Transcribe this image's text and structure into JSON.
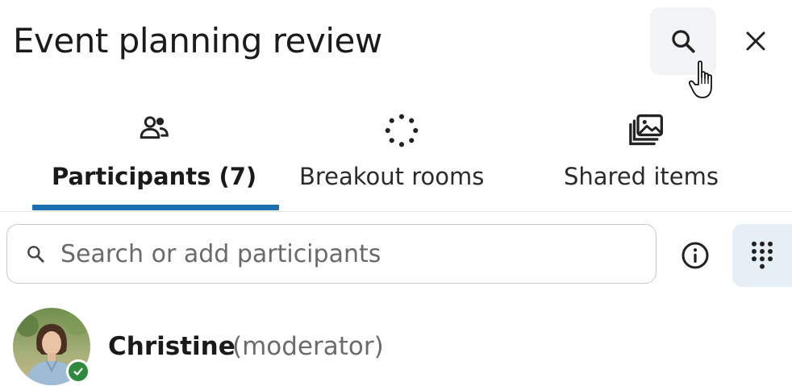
{
  "header": {
    "title": "Event planning review"
  },
  "tabs": [
    {
      "label": "Participants (7)",
      "icon": "people-icon",
      "active": true
    },
    {
      "label": "Breakout rooms",
      "icon": "breakout-rooms-icon",
      "active": false
    },
    {
      "label": "Shared items",
      "icon": "shared-items-icon",
      "active": false
    }
  ],
  "search": {
    "placeholder": "Search or add participants",
    "value": ""
  },
  "participants": [
    {
      "name": "Christine",
      "role": "(moderator)",
      "status": "available"
    }
  ],
  "colors": {
    "accent": "#1b6fb3",
    "status_available": "#2e8b3d",
    "hover_bg": "#f1f3f5",
    "dialpad_bg": "#e6eef6"
  }
}
